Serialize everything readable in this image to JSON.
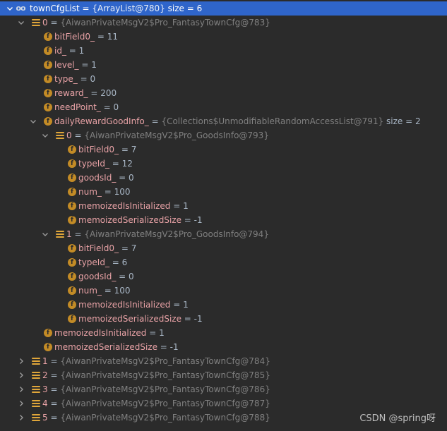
{
  "rows": [
    {
      "indent": 0,
      "arrow": "down",
      "icon": "oo",
      "name": "townCfgList",
      "type": "{ArrayList@780}",
      "value": "size = 6",
      "selected": true
    },
    {
      "indent": 1,
      "arrow": "down",
      "icon": "list",
      "name": "0",
      "type": "{AiwanPrivateMsgV2$Pro_FantasyTownCfg@783}",
      "value": ""
    },
    {
      "indent": 2,
      "arrow": "none",
      "icon": "f",
      "name": "bitField0_",
      "type": "",
      "value": "11"
    },
    {
      "indent": 2,
      "arrow": "none",
      "icon": "f",
      "name": "id_",
      "type": "",
      "value": "1"
    },
    {
      "indent": 2,
      "arrow": "none",
      "icon": "f",
      "name": "level_",
      "type": "",
      "value": "1"
    },
    {
      "indent": 2,
      "arrow": "none",
      "icon": "f",
      "name": "type_",
      "type": "",
      "value": "0"
    },
    {
      "indent": 2,
      "arrow": "none",
      "icon": "f",
      "name": "reward_",
      "type": "",
      "value": "200"
    },
    {
      "indent": 2,
      "arrow": "none",
      "icon": "f",
      "name": "needPoint_",
      "type": "",
      "value": "0"
    },
    {
      "indent": 2,
      "arrow": "down",
      "icon": "f",
      "name": "dailyRewardGoodInfo_",
      "type": "{Collections$UnmodifiableRandomAccessList@791}",
      "value": "size = 2"
    },
    {
      "indent": 3,
      "arrow": "down",
      "icon": "list",
      "name": "0",
      "type": "{AiwanPrivateMsgV2$Pro_GoodsInfo@793}",
      "value": ""
    },
    {
      "indent": 4,
      "arrow": "none",
      "icon": "f",
      "name": "bitField0_",
      "type": "",
      "value": "7"
    },
    {
      "indent": 4,
      "arrow": "none",
      "icon": "f",
      "name": "typeId_",
      "type": "",
      "value": "12"
    },
    {
      "indent": 4,
      "arrow": "none",
      "icon": "f",
      "name": "goodsId_",
      "type": "",
      "value": "0"
    },
    {
      "indent": 4,
      "arrow": "none",
      "icon": "f",
      "name": "num_",
      "type": "",
      "value": "100"
    },
    {
      "indent": 4,
      "arrow": "none",
      "icon": "f",
      "name": "memoizedIsInitialized",
      "type": "",
      "value": "1"
    },
    {
      "indent": 4,
      "arrow": "none",
      "icon": "f",
      "name": "memoizedSerializedSize",
      "type": "",
      "value": "-1"
    },
    {
      "indent": 3,
      "arrow": "down",
      "icon": "list",
      "name": "1",
      "type": "{AiwanPrivateMsgV2$Pro_GoodsInfo@794}",
      "value": ""
    },
    {
      "indent": 4,
      "arrow": "none",
      "icon": "f",
      "name": "bitField0_",
      "type": "",
      "value": "7"
    },
    {
      "indent": 4,
      "arrow": "none",
      "icon": "f",
      "name": "typeId_",
      "type": "",
      "value": "6"
    },
    {
      "indent": 4,
      "arrow": "none",
      "icon": "f",
      "name": "goodsId_",
      "type": "",
      "value": "0"
    },
    {
      "indent": 4,
      "arrow": "none",
      "icon": "f",
      "name": "num_",
      "type": "",
      "value": "100"
    },
    {
      "indent": 4,
      "arrow": "none",
      "icon": "f",
      "name": "memoizedIsInitialized",
      "type": "",
      "value": "1"
    },
    {
      "indent": 4,
      "arrow": "none",
      "icon": "f",
      "name": "memoizedSerializedSize",
      "type": "",
      "value": "-1"
    },
    {
      "indent": 2,
      "arrow": "none",
      "icon": "f",
      "name": "memoizedIsInitialized",
      "type": "",
      "value": "1"
    },
    {
      "indent": 2,
      "arrow": "none",
      "icon": "f",
      "name": "memoizedSerializedSize",
      "type": "",
      "value": "-1"
    },
    {
      "indent": 1,
      "arrow": "right",
      "icon": "list",
      "name": "1",
      "type": "{AiwanPrivateMsgV2$Pro_FantasyTownCfg@784}",
      "value": ""
    },
    {
      "indent": 1,
      "arrow": "right",
      "icon": "list",
      "name": "2",
      "type": "{AiwanPrivateMsgV2$Pro_FantasyTownCfg@785}",
      "value": ""
    },
    {
      "indent": 1,
      "arrow": "right",
      "icon": "list",
      "name": "3",
      "type": "{AiwanPrivateMsgV2$Pro_FantasyTownCfg@786}",
      "value": ""
    },
    {
      "indent": 1,
      "arrow": "right",
      "icon": "list",
      "name": "4",
      "type": "{AiwanPrivateMsgV2$Pro_FantasyTownCfg@787}",
      "value": ""
    },
    {
      "indent": 1,
      "arrow": "right",
      "icon": "list",
      "name": "5",
      "type": "{AiwanPrivateMsgV2$Pro_FantasyTownCfg@788}",
      "value": ""
    }
  ],
  "watermark": "CSDN @spring呀",
  "colors": {
    "background": "#2b2b2b",
    "selection": "#2f65ca",
    "field_name": "#e8a2a6",
    "type_text": "#808080",
    "value_text": "#a9b7c6",
    "field_icon": "#c38b26",
    "list_icon": "#e0a63a"
  },
  "icons": {
    "expanded": "chevron-down-icon",
    "collapsed": "chevron-right-icon",
    "field": "field-icon",
    "list": "list-icon",
    "watch": "watch-icon"
  }
}
